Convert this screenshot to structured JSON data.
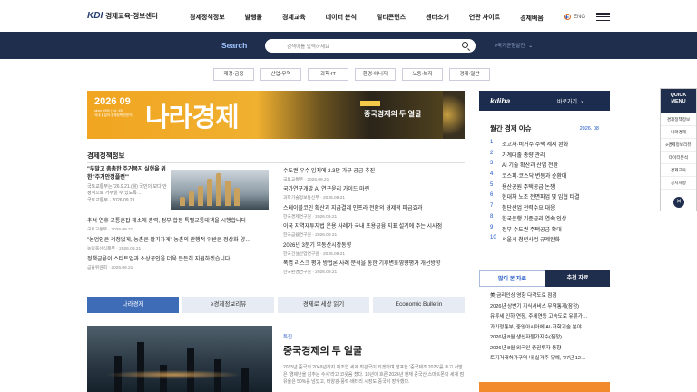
{
  "header": {
    "logo_brand": "KDI",
    "logo_text": "경제교육·정보센터",
    "nav": [
      "경제정책정보",
      "발행물",
      "경제교육",
      "데이터 분석",
      "멀티콘텐츠",
      "센터소개",
      "연관 사이트"
    ],
    "nav_highlight": "경제배움",
    "lang": "ENG"
  },
  "search": {
    "label": "Search",
    "placeholder": "검색어를 입력하세요",
    "hashtag": "#국가균형발전"
  },
  "topics": [
    "재정·금융",
    "산업·무역",
    "과학·IT",
    "환경·에너지",
    "노동·복지",
    "경제·일반"
  ],
  "banner": {
    "year": "2026 09",
    "since": "since 1990 | vol. 430",
    "sub": "국내 유일의 경제정책 전문지",
    "title": "나라경제",
    "caption": "중국경제의 두 얼굴"
  },
  "kdiba": {
    "logo": "kdiba",
    "go": "바로가기"
  },
  "issue": {
    "title": "월간 경제 이슈",
    "date": "2026. 08",
    "items": [
      {
        "n": "1",
        "t": "조고차·비거주 주택 세제 완화"
      },
      {
        "n": "2",
        "t": "가계대출 총량 관리"
      },
      {
        "n": "3",
        "t": "AI 기술 확산과 산업 전환"
      },
      {
        "n": "4",
        "t": "코스피·코스닥 변동과 순환매"
      },
      {
        "n": "5",
        "t": "용산공원 주택공급 논쟁"
      },
      {
        "n": "6",
        "t": "현대차 노조 전면파업 및 임협 타결"
      },
      {
        "n": "7",
        "t": "첨단산업 전력수요 대응"
      },
      {
        "n": "8",
        "t": "한국은행 기준금리 연속 인상"
      },
      {
        "n": "9",
        "t": "정부 수도권 주택공급 확대"
      },
      {
        "n": "10",
        "t": "서울시 청년사업 규제완화"
      }
    ]
  },
  "quick": {
    "title1": "QUICK",
    "title2": "MENU",
    "items": [
      "경제정책정보",
      "나라경제",
      "e경제정보리뷰",
      "데이터분석",
      "경제교육",
      "공지사항"
    ],
    "close": "✕"
  },
  "policy": {
    "title": "경제정책정보",
    "feature": {
      "t": "\"두말고 촘촘한 주거복지 실현을 위한 '주거안정플랜'\"",
      "s": "국토교통부는 '26.9.21.(월) 국민의 보다 안정적으로 거주할 수 있도록…",
      "s2": "국토교통부 · 2026.09.21"
    },
    "left_items": [
      {
        "t": "추석 연휴 교통혼잡 해소에 총력, 정부 합동 특별교통대책을 시행합니다",
        "s": "국토교통부 · 2026.09.21"
      },
      {
        "t": "\"농업인은 걱정없게, 농촌은 활기차게\" 농촌의 관행적 위반은 정상화·양…",
        "s": "농림축산식품부 · 2026.09.21"
      },
      {
        "t": "정책금융이 스타트업과 소상공인을 더욱 든든히 지원하겠습니다.",
        "s": "금융위원회 · 2026.09.21"
      }
    ],
    "mid_items": [
      {
        "t": "수도권 우수 입지에 2.3만 가구 공급 추진",
        "s": "국토교통부 · 2026.09.21"
      },
      {
        "t": "국가연구개발 AI 연구윤리 가이드 마련",
        "s": "과학기술정보통신부 · 2026.09.21"
      },
      {
        "t": "스테이블코인 확산과 지급결제 인프라 전환의 경제적 파급효과",
        "s": "한국경제연구원 · 2026.09.21"
      },
      {
        "t": "이국 지역재투자법 운용 사례가 국내 포용금융 지표 설계에 주는 시사점",
        "s": "한국금융연구원 · 2026.09.21"
      },
      {
        "t": "2026년 3분기 부동산시장동향",
        "s": "한국건설산업연구원 · 2026.09.21"
      },
      {
        "t": "폭염 리스크 평가 방법론 사례 분석을 통한 기후변화영향평가 개선방향",
        "s": "한국환경연구원 · 2026.09.21"
      }
    ]
  },
  "tabs": [
    "나라경제",
    "e경제정보리뷰",
    "경제로 세상 읽기",
    "Economic Bulletin"
  ],
  "feature2": {
    "tag": "특집",
    "title": "중국경제의 두 얼굴",
    "p": "2015년 중국의 2049년까지 제조업 세계 최강국이 되겠다며 발표한 '중국제조 2025'를 두고 서방은 '경제난을 감추는 수사'라고 코웃음 쳤다. 10년이 흐른 2026년 현재 중국산 스마트폰의 세계 점유율은 50%를 넘었고, 태양광·풍력·배터리 시장도 중국이 장악했다."
  },
  "popular": {
    "tab_a": "많이 본 자료",
    "tab_b": "추천 자료",
    "items": [
      "美 금리인상 영향 다각도로 점검",
      "2026년 상반기 지식서비스 무역통계(잠정)",
      "유류세 인하 연장, 주세연동 고속도로 유류가…",
      "과기정통부, 중앙아시아에 AI·과학기술 분야…",
      "2026년 8월 생산자물가지수(잠정)",
      "2026년 8월 외국인 증권투자 동향",
      "토지거래허가구역 내 실거주 유예, '27년 12…"
    ]
  },
  "colors": {
    "navy": "#1e2e4c",
    "accent": "#1f55c7",
    "orange": "#f28a2c",
    "tab_active": "#3e6cb6"
  }
}
